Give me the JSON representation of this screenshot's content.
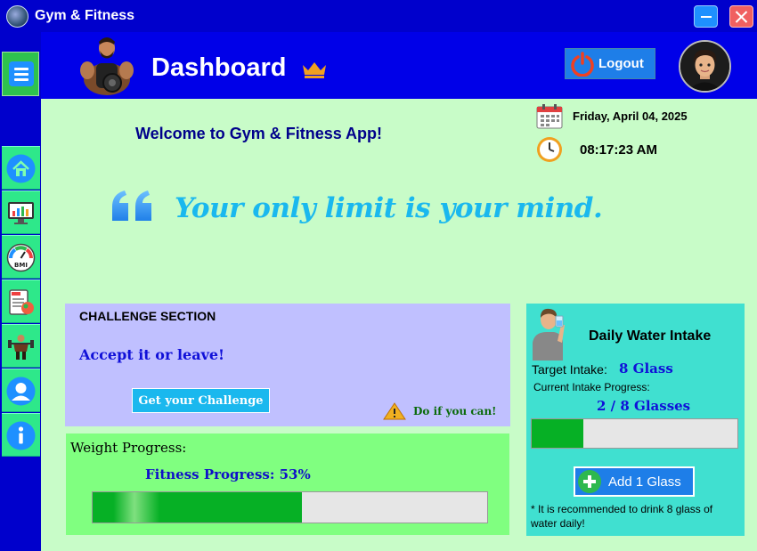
{
  "window": {
    "title": "Gym & Fitness"
  },
  "header": {
    "title": "Dashboard",
    "logout_label": "Logout"
  },
  "sidebar": {
    "items": [
      {
        "name": "home",
        "icon": "home-icon"
      },
      {
        "name": "dashboard-stats",
        "icon": "monitor-chart-icon"
      },
      {
        "name": "bmi",
        "icon": "bmi-gauge-icon"
      },
      {
        "name": "diet",
        "icon": "diet-plan-icon"
      },
      {
        "name": "workout",
        "icon": "bodybuilder-icon"
      },
      {
        "name": "profile",
        "icon": "user-icon"
      },
      {
        "name": "about",
        "icon": "info-icon"
      }
    ]
  },
  "main": {
    "welcome": "Welcome to Gym & Fitness App!",
    "date": "Friday, April 04, 2025",
    "time": "08:17:23 AM",
    "quote": "Your only limit is your mind."
  },
  "challenge": {
    "title": "CHALLENGE SECTION",
    "subtitle": "Accept it or leave!",
    "button_label": "Get your Challenge",
    "warning": "Do if you can!"
  },
  "weight": {
    "title": "Weight Progress:",
    "progress_label": "Fitness Progress: 53%",
    "progress": 0.53
  },
  "water": {
    "title": "Daily Water Intake",
    "target_label": "Target Intake:",
    "target_value": "8 Glass",
    "current_label": "Current Intake Progress:",
    "glasses_text": "2 / 8 Glasses",
    "progress": 0.25,
    "add_label": "Add 1 Glass",
    "note": "* It is recommended to drink 8 glass of water daily!"
  },
  "colors": {
    "titlebar": "#0000cc",
    "header": "#0000e8",
    "main_bg": "#c8fcc8",
    "quote": "#1ab8ee",
    "challenge_bg": "#c0c0ff",
    "weight_bg": "#80ff80",
    "water_bg": "#40e0d0",
    "progress_fill": "#06b025"
  }
}
